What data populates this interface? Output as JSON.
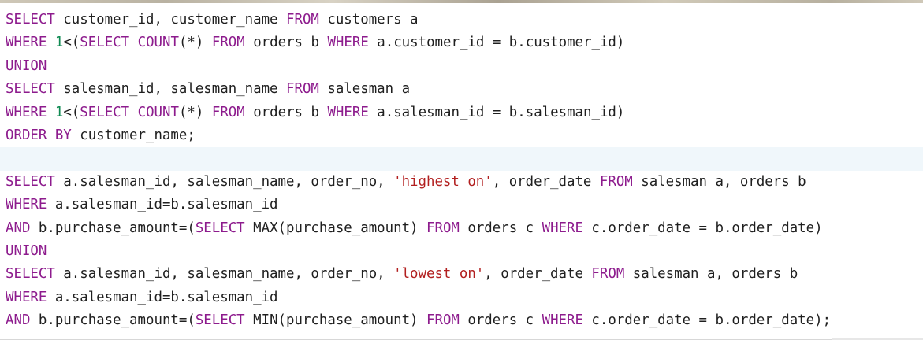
{
  "editor": {
    "lines": [
      [
        {
          "type": "kw",
          "text": "SELECT"
        },
        {
          "type": "plain",
          "text": " customer_id, customer_name "
        },
        {
          "type": "kw",
          "text": "FROM"
        },
        {
          "type": "plain",
          "text": " customers a"
        }
      ],
      [
        {
          "type": "kw",
          "text": "WHERE"
        },
        {
          "type": "plain",
          "text": " "
        },
        {
          "type": "num",
          "text": "1"
        },
        {
          "type": "plain",
          "text": "<("
        },
        {
          "type": "kw",
          "text": "SELECT"
        },
        {
          "type": "plain",
          "text": " "
        },
        {
          "type": "fn",
          "text": "COUNT"
        },
        {
          "type": "plain",
          "text": "(*) "
        },
        {
          "type": "kw",
          "text": "FROM"
        },
        {
          "type": "plain",
          "text": " orders b "
        },
        {
          "type": "kw",
          "text": "WHERE"
        },
        {
          "type": "plain",
          "text": " a.customer_id = b.customer_id)"
        }
      ],
      [
        {
          "type": "kw",
          "text": "UNION"
        }
      ],
      [
        {
          "type": "kw",
          "text": "SELECT"
        },
        {
          "type": "plain",
          "text": " salesman_id, salesman_name "
        },
        {
          "type": "kw",
          "text": "FROM"
        },
        {
          "type": "plain",
          "text": " salesman a"
        }
      ],
      [
        {
          "type": "kw",
          "text": "WHERE"
        },
        {
          "type": "plain",
          "text": " "
        },
        {
          "type": "num",
          "text": "1"
        },
        {
          "type": "plain",
          "text": "<("
        },
        {
          "type": "kw",
          "text": "SELECT"
        },
        {
          "type": "plain",
          "text": " "
        },
        {
          "type": "fn",
          "text": "COUNT"
        },
        {
          "type": "plain",
          "text": "(*) "
        },
        {
          "type": "kw",
          "text": "FROM"
        },
        {
          "type": "plain",
          "text": " orders b "
        },
        {
          "type": "kw",
          "text": "WHERE"
        },
        {
          "type": "plain",
          "text": " a.salesman_id = b.salesman_id)"
        }
      ],
      [
        {
          "type": "kw",
          "text": "ORDER BY"
        },
        {
          "type": "plain",
          "text": " customer_name;"
        }
      ],
      [],
      [
        {
          "type": "kw",
          "text": "SELECT"
        },
        {
          "type": "plain",
          "text": " a.salesman_id, salesman_name, order_no, "
        },
        {
          "type": "str",
          "text": "'highest on'"
        },
        {
          "type": "plain",
          "text": ", order_date "
        },
        {
          "type": "kw",
          "text": "FROM"
        },
        {
          "type": "plain",
          "text": " salesman a, orders b"
        }
      ],
      [
        {
          "type": "kw",
          "text": "WHERE"
        },
        {
          "type": "plain",
          "text": " a.salesman_id=b.salesman_id"
        }
      ],
      [
        {
          "type": "kw",
          "text": "AND"
        },
        {
          "type": "plain",
          "text": " b.purchase_amount=("
        },
        {
          "type": "kw",
          "text": "SELECT"
        },
        {
          "type": "plain",
          "text": " MAX(purchase_amount) "
        },
        {
          "type": "kw",
          "text": "FROM"
        },
        {
          "type": "plain",
          "text": " orders c "
        },
        {
          "type": "kw",
          "text": "WHERE"
        },
        {
          "type": "plain",
          "text": " c.order_date = b.order_date)"
        }
      ],
      [
        {
          "type": "kw",
          "text": "UNION"
        }
      ],
      [
        {
          "type": "kw",
          "text": "SELECT"
        },
        {
          "type": "plain",
          "text": " a.salesman_id, salesman_name, order_no, "
        },
        {
          "type": "str",
          "text": "'lowest on'"
        },
        {
          "type": "plain",
          "text": ", order_date "
        },
        {
          "type": "kw",
          "text": "FROM"
        },
        {
          "type": "plain",
          "text": " salesman a, orders b"
        }
      ],
      [
        {
          "type": "kw",
          "text": "WHERE"
        },
        {
          "type": "plain",
          "text": " a.salesman_id=b.salesman_id"
        }
      ],
      [
        {
          "type": "kw",
          "text": "AND"
        },
        {
          "type": "plain",
          "text": " b.purchase_amount=("
        },
        {
          "type": "kw",
          "text": "SELECT"
        },
        {
          "type": "plain",
          "text": " MIN(purchase_amount) "
        },
        {
          "type": "kw",
          "text": "FROM"
        },
        {
          "type": "plain",
          "text": " orders c "
        },
        {
          "type": "kw",
          "text": "WHERE"
        },
        {
          "type": "plain",
          "text": " c.order_date = b.order_date);"
        }
      ]
    ]
  }
}
